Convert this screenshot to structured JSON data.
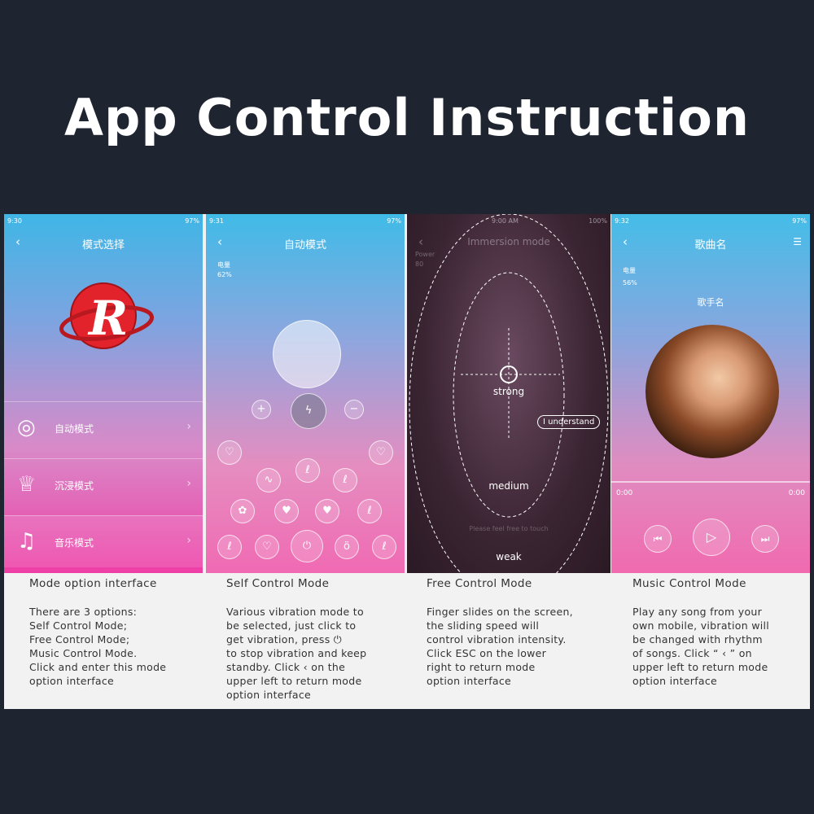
{
  "title": "App Control Instruction",
  "screens": {
    "mode_select": {
      "time": "9:30",
      "battery": "97%",
      "nav_title": "模式选择",
      "items": [
        {
          "label": "自动模式",
          "icon": "target-icon"
        },
        {
          "label": "沉浸模式",
          "icon": "cup-icon"
        },
        {
          "label": "音乐模式",
          "icon": "music-note-icon"
        }
      ]
    },
    "self_control": {
      "time": "9:31",
      "battery": "97%",
      "nav_title": "自动模式",
      "power_label": "电量",
      "power_value": "62%"
    },
    "free_control": {
      "time": "9:00 AM",
      "battery": "100%",
      "nav_title": "Immersion mode",
      "power_label": "Power",
      "power_value": "80",
      "strong": "strong",
      "medium": "medium",
      "weak": "weak",
      "understand": "I understand",
      "hint": "Please feel free to touch"
    },
    "music_control": {
      "time": "9:32",
      "battery": "97%",
      "nav_title": "歌曲名",
      "power_label": "电量",
      "power_value": "56%",
      "artist": "歌手名",
      "time_start": "0:00",
      "time_end": "0:00"
    }
  },
  "captions": [
    {
      "head": "Mode option interface",
      "body": "There are 3 options:\nSelf Control Mode;\nFree Control Mode;\nMusic Control Mode.\nClick and enter this mode\noption interface"
    },
    {
      "head": "Self Control Mode",
      "body": "Various vibration mode to\nbe selected, just click to\nget vibration, press ⏻\nto stop vibration and keep\nstandby. Click  ‹  on the\nupper left to return mode\noption interface"
    },
    {
      "head": "Free Control Mode",
      "body": "Finger slides on the screen,\nthe sliding speed will\ncontrol vibration intensity.\nClick ESC on the lower\nright to return mode\noption interface"
    },
    {
      "head": "Music Control Mode",
      "body": "Play any song from your\nown mobile, vibration will\nbe changed with rhythm\nof songs. Click “ ‹ ” on\nupper left to return mode\noption interface"
    }
  ]
}
